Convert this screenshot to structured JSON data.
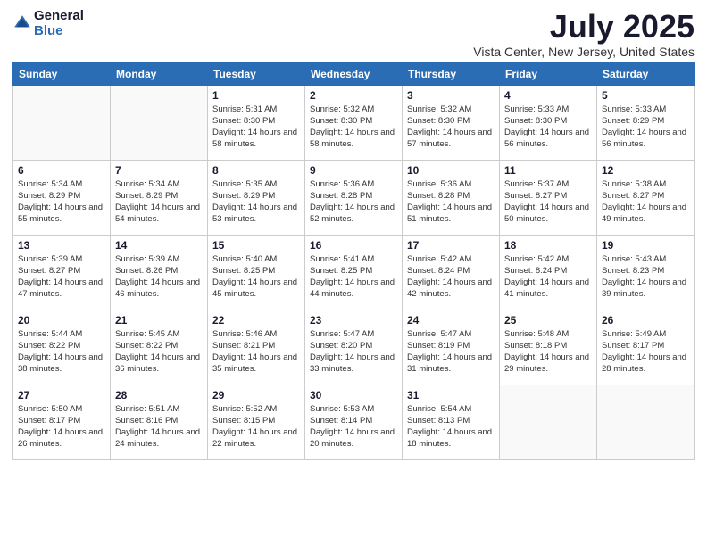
{
  "logo": {
    "general": "General",
    "blue": "Blue"
  },
  "title": "July 2025",
  "location": "Vista Center, New Jersey, United States",
  "weekdays": [
    "Sunday",
    "Monday",
    "Tuesday",
    "Wednesday",
    "Thursday",
    "Friday",
    "Saturday"
  ],
  "weeks": [
    [
      {
        "day": "",
        "info": ""
      },
      {
        "day": "",
        "info": ""
      },
      {
        "day": "1",
        "info": "Sunrise: 5:31 AM\nSunset: 8:30 PM\nDaylight: 14 hours and 58 minutes."
      },
      {
        "day": "2",
        "info": "Sunrise: 5:32 AM\nSunset: 8:30 PM\nDaylight: 14 hours and 58 minutes."
      },
      {
        "day": "3",
        "info": "Sunrise: 5:32 AM\nSunset: 8:30 PM\nDaylight: 14 hours and 57 minutes."
      },
      {
        "day": "4",
        "info": "Sunrise: 5:33 AM\nSunset: 8:30 PM\nDaylight: 14 hours and 56 minutes."
      },
      {
        "day": "5",
        "info": "Sunrise: 5:33 AM\nSunset: 8:29 PM\nDaylight: 14 hours and 56 minutes."
      }
    ],
    [
      {
        "day": "6",
        "info": "Sunrise: 5:34 AM\nSunset: 8:29 PM\nDaylight: 14 hours and 55 minutes."
      },
      {
        "day": "7",
        "info": "Sunrise: 5:34 AM\nSunset: 8:29 PM\nDaylight: 14 hours and 54 minutes."
      },
      {
        "day": "8",
        "info": "Sunrise: 5:35 AM\nSunset: 8:29 PM\nDaylight: 14 hours and 53 minutes."
      },
      {
        "day": "9",
        "info": "Sunrise: 5:36 AM\nSunset: 8:28 PM\nDaylight: 14 hours and 52 minutes."
      },
      {
        "day": "10",
        "info": "Sunrise: 5:36 AM\nSunset: 8:28 PM\nDaylight: 14 hours and 51 minutes."
      },
      {
        "day": "11",
        "info": "Sunrise: 5:37 AM\nSunset: 8:27 PM\nDaylight: 14 hours and 50 minutes."
      },
      {
        "day": "12",
        "info": "Sunrise: 5:38 AM\nSunset: 8:27 PM\nDaylight: 14 hours and 49 minutes."
      }
    ],
    [
      {
        "day": "13",
        "info": "Sunrise: 5:39 AM\nSunset: 8:27 PM\nDaylight: 14 hours and 47 minutes."
      },
      {
        "day": "14",
        "info": "Sunrise: 5:39 AM\nSunset: 8:26 PM\nDaylight: 14 hours and 46 minutes."
      },
      {
        "day": "15",
        "info": "Sunrise: 5:40 AM\nSunset: 8:25 PM\nDaylight: 14 hours and 45 minutes."
      },
      {
        "day": "16",
        "info": "Sunrise: 5:41 AM\nSunset: 8:25 PM\nDaylight: 14 hours and 44 minutes."
      },
      {
        "day": "17",
        "info": "Sunrise: 5:42 AM\nSunset: 8:24 PM\nDaylight: 14 hours and 42 minutes."
      },
      {
        "day": "18",
        "info": "Sunrise: 5:42 AM\nSunset: 8:24 PM\nDaylight: 14 hours and 41 minutes."
      },
      {
        "day": "19",
        "info": "Sunrise: 5:43 AM\nSunset: 8:23 PM\nDaylight: 14 hours and 39 minutes."
      }
    ],
    [
      {
        "day": "20",
        "info": "Sunrise: 5:44 AM\nSunset: 8:22 PM\nDaylight: 14 hours and 38 minutes."
      },
      {
        "day": "21",
        "info": "Sunrise: 5:45 AM\nSunset: 8:22 PM\nDaylight: 14 hours and 36 minutes."
      },
      {
        "day": "22",
        "info": "Sunrise: 5:46 AM\nSunset: 8:21 PM\nDaylight: 14 hours and 35 minutes."
      },
      {
        "day": "23",
        "info": "Sunrise: 5:47 AM\nSunset: 8:20 PM\nDaylight: 14 hours and 33 minutes."
      },
      {
        "day": "24",
        "info": "Sunrise: 5:47 AM\nSunset: 8:19 PM\nDaylight: 14 hours and 31 minutes."
      },
      {
        "day": "25",
        "info": "Sunrise: 5:48 AM\nSunset: 8:18 PM\nDaylight: 14 hours and 29 minutes."
      },
      {
        "day": "26",
        "info": "Sunrise: 5:49 AM\nSunset: 8:17 PM\nDaylight: 14 hours and 28 minutes."
      }
    ],
    [
      {
        "day": "27",
        "info": "Sunrise: 5:50 AM\nSunset: 8:17 PM\nDaylight: 14 hours and 26 minutes."
      },
      {
        "day": "28",
        "info": "Sunrise: 5:51 AM\nSunset: 8:16 PM\nDaylight: 14 hours and 24 minutes."
      },
      {
        "day": "29",
        "info": "Sunrise: 5:52 AM\nSunset: 8:15 PM\nDaylight: 14 hours and 22 minutes."
      },
      {
        "day": "30",
        "info": "Sunrise: 5:53 AM\nSunset: 8:14 PM\nDaylight: 14 hours and 20 minutes."
      },
      {
        "day": "31",
        "info": "Sunrise: 5:54 AM\nSunset: 8:13 PM\nDaylight: 14 hours and 18 minutes."
      },
      {
        "day": "",
        "info": ""
      },
      {
        "day": "",
        "info": ""
      }
    ]
  ]
}
